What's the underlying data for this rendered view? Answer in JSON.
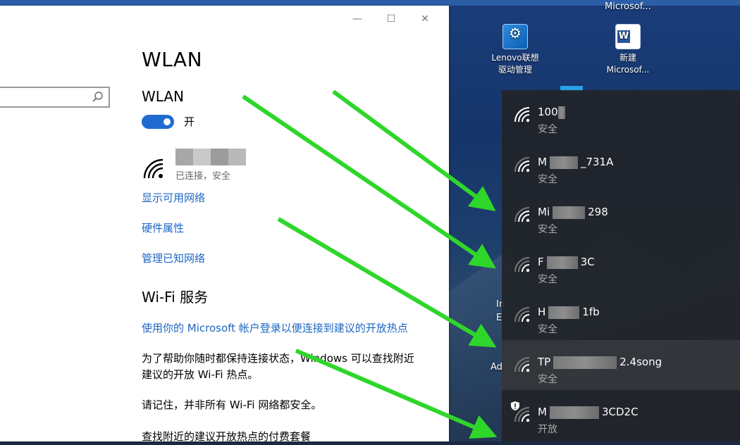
{
  "desktop": {
    "icons": [
      {
        "label_line1": "Lenovo联想",
        "label_line2": "驱动管理"
      },
      {
        "label_line1": "新建",
        "label_line2": "Microsof..."
      }
    ],
    "top_right_label": "Microsof...",
    "edge_letters": [
      "In",
      "E",
      "Ad"
    ]
  },
  "window": {
    "controls": {
      "minimize": "—",
      "maximize": "☐",
      "close": "✕"
    }
  },
  "search": {
    "value": ""
  },
  "settings": {
    "page_title": "WLAN",
    "wlan_section_title": "WLAN",
    "toggle": {
      "state": "on",
      "label": "开"
    },
    "connected_network": {
      "status": "已连接，安全"
    },
    "links": [
      "显示可用网络",
      "硬件属性",
      "管理已知网络"
    ],
    "wifi_services_title": "Wi-Fi 服务",
    "ms_account_link": "使用你的 Microsoft 帐户登录以便连接到建议的开放热点",
    "para1_line1": "为了帮助你随时都保持连接状态，Windows 可以查找附近",
    "para1_line2": "建议的开放 Wi-Fi 热点。",
    "para2": "请记住，并非所有 Wi-Fi 网络都安全。",
    "para3": "查找附近的建议开放热点的付费套餐"
  },
  "flyout": {
    "networks": [
      {
        "name_a": "100",
        "name_b": "",
        "state": "安全",
        "secured": true
      },
      {
        "name_a": "M",
        "name_b": "_731A",
        "state": "安全",
        "secured": true
      },
      {
        "name_a": "Mi",
        "name_b": "298",
        "state": "安全",
        "secured": true
      },
      {
        "name_a": "F",
        "name_b": "3C",
        "state": "安全",
        "secured": true
      },
      {
        "name_a": "H",
        "name_b": "1fb",
        "state": "安全",
        "secured": true
      },
      {
        "name_a": "TP",
        "name_b": "2.4song",
        "state": "安全",
        "secured": true
      },
      {
        "name_a": "M",
        "name_b": "3CD2C",
        "state": "开放",
        "secured": false
      }
    ]
  },
  "colors": {
    "accent": "#1f6bd2",
    "link": "#1c66c4",
    "arrow": "#2fd62a"
  }
}
